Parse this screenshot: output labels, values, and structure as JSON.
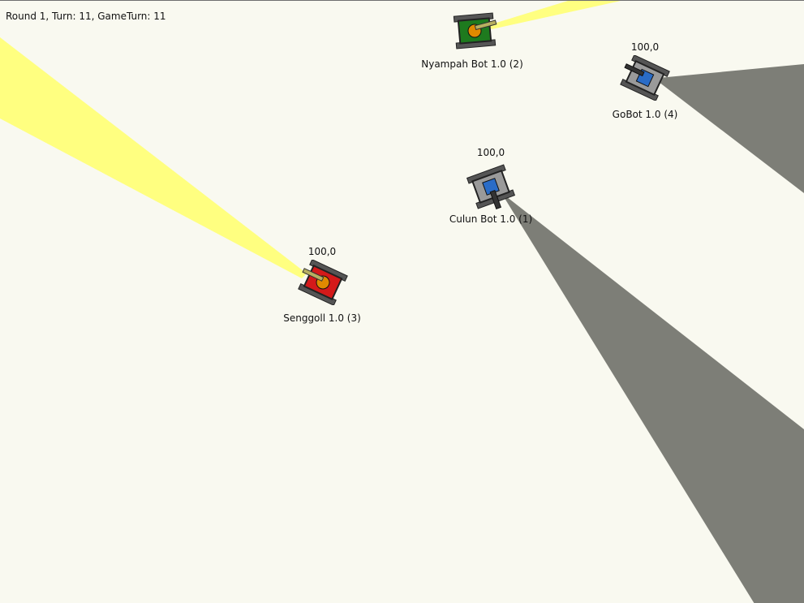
{
  "status": {
    "text": "Round 1, Turn: 11, GameTurn: 11"
  },
  "colors": {
    "background": "#f9f9f0",
    "scan_yellow": "#ffff80",
    "scan_gray": "#7d7e77"
  },
  "robots": [
    {
      "name": "Culun Bot 1.0 (1)",
      "energy": "100,0",
      "body_color": "#9a9a9a",
      "turret_color": "#2a6cc7",
      "icon": "tank-icon"
    },
    {
      "name": "Nyampah Bot 1.0 (2)",
      "energy": "",
      "body_color": "#1e7a1e",
      "turret_color": "#e08a00",
      "icon": "tank-icon"
    },
    {
      "name": "Senggoll 1.0 (3)",
      "energy": "100,0",
      "body_color": "#d41a1a",
      "turret_color": "#e08a00",
      "icon": "tank-icon"
    },
    {
      "name": "GoBot 1.0 (4)",
      "energy": "100,0",
      "body_color": "#9a9a9a",
      "turret_color": "#2a6cc7",
      "icon": "tank-icon"
    }
  ]
}
